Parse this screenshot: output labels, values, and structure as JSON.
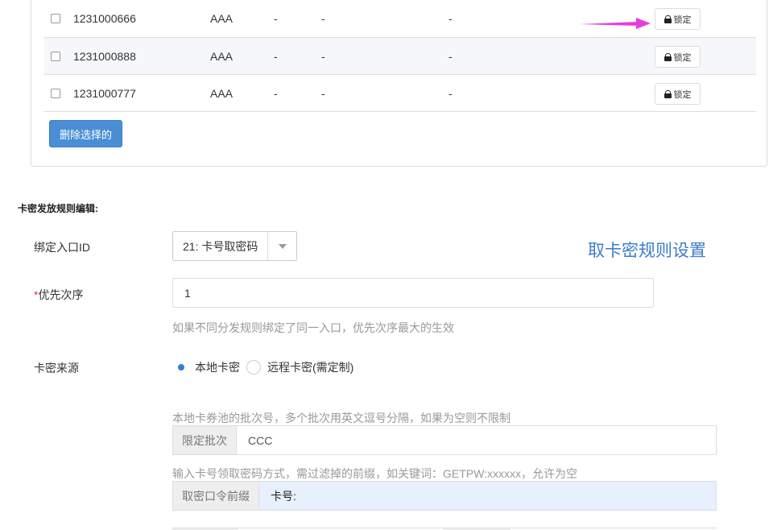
{
  "table": {
    "rows": [
      {
        "id": "1231000666",
        "col2": "AAA",
        "col3": "-",
        "col4": "-",
        "col5": "-",
        "action": "锁定"
      },
      {
        "id": "1231000888",
        "col2": "AAA",
        "col3": "-",
        "col4": "-",
        "col5": "-",
        "action": "锁定"
      },
      {
        "id": "1231000777",
        "col2": "AAA",
        "col3": "-",
        "col4": "-",
        "col5": "-",
        "action": "锁定"
      }
    ],
    "delete_selected_label": "删除选择的",
    "arrow_color": "#e83ce0"
  },
  "section": {
    "title": "卡密发放规则编辑:"
  },
  "form": {
    "entry_id_label": "绑定入口ID",
    "entry_id_value": "21: 卡号取密码",
    "rule_title": "取卡密规则设置",
    "priority_star": "*",
    "priority_label": "优先次序",
    "priority_value": "1",
    "priority_help": "如果不同分发规则绑定了同一入口，优先次序最大的生效",
    "source_label": "卡密来源",
    "source_options": [
      {
        "label": "本地卡密",
        "selected": true
      },
      {
        "label": "远程卡密(需定制)",
        "selected": false
      }
    ],
    "batch_help": "本地卡券池的批次号，多个批次用英文逗号分隔，如果为空则不限制",
    "batch_addon": "限定批次",
    "batch_value": "CCC",
    "prefix_help": "输入卡号领取密码方式，需过滤掉的前缀，如关键词：GETPW:xxxxxx，允许为空",
    "prefix_addon": "取密口令前缀",
    "prefix_value": "卡号:"
  },
  "colors": {
    "accent": "#4a8fd6",
    "title_blue": "#3a7ccc",
    "highlight_input": "#e8f0fe"
  }
}
